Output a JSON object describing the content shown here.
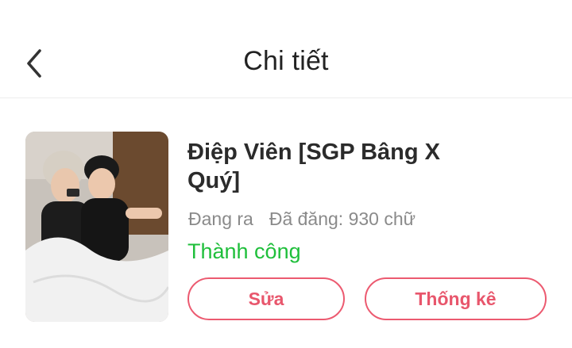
{
  "header": {
    "title": "Chi tiết",
    "back_icon": "chevron-left-icon"
  },
  "story": {
    "title": "Điệp Viên [SGP Bâng X Quý]",
    "state": "Đang ra",
    "word_count": "Đã đăng: 930 chữ",
    "status": "Thành công",
    "edit_label": "Sửa",
    "stats_label": "Thống kê"
  },
  "colors": {
    "accent": "#ec5a70",
    "success": "#1fbf3b",
    "muted_text": "#8a8a8a",
    "title_text": "#222222"
  }
}
